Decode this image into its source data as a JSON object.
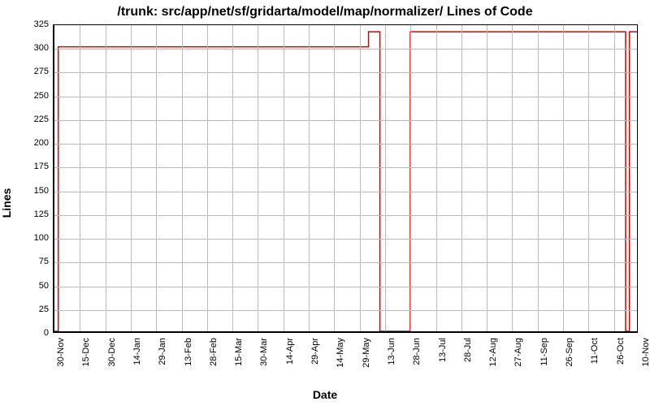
{
  "chart_data": {
    "type": "line",
    "title": "/trunk: src/app/net/sf/gridarta/model/map/normalizer/ Lines of Code",
    "xlabel": "Date",
    "ylabel": "Lines",
    "ylim": [
      0,
      325
    ],
    "yticks": [
      0,
      25,
      50,
      75,
      100,
      125,
      150,
      175,
      200,
      225,
      250,
      275,
      300,
      325
    ],
    "categories": [
      "30-Nov",
      "15-Dec",
      "30-Dec",
      "14-Jan",
      "29-Jan",
      "13-Feb",
      "28-Feb",
      "15-Mar",
      "30-Mar",
      "14-Apr",
      "29-Apr",
      "14-May",
      "29-May",
      "13-Jun",
      "28-Jun",
      "13-Jul",
      "28-Jul",
      "12-Aug",
      "27-Aug",
      "11-Sep",
      "26-Sep",
      "11-Oct",
      "26-Oct",
      "10-Nov"
    ],
    "series": [
      {
        "name": "lines",
        "color": "#d40000",
        "points": [
          {
            "xi": 0.0,
            "y": 0
          },
          {
            "xi": 0.15,
            "y": 0
          },
          {
            "xi": 0.15,
            "y": 302
          },
          {
            "xi": 12.4,
            "y": 302
          },
          {
            "xi": 12.4,
            "y": 318
          },
          {
            "xi": 12.85,
            "y": 318
          },
          {
            "xi": 12.85,
            "y": 0
          },
          {
            "xi": 14.05,
            "y": 0
          },
          {
            "xi": 14.05,
            "y": 318
          },
          {
            "xi": 22.55,
            "y": 318
          },
          {
            "xi": 22.55,
            "y": 0
          },
          {
            "xi": 22.7,
            "y": 0
          },
          {
            "xi": 22.7,
            "y": 318
          },
          {
            "xi": 23.0,
            "y": 318
          }
        ]
      }
    ]
  }
}
